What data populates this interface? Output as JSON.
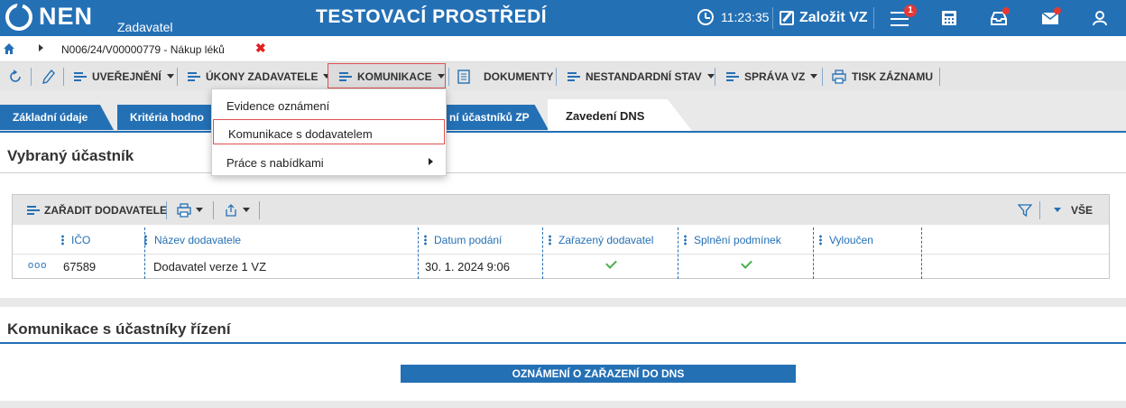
{
  "header": {
    "brand": "NEN",
    "brand_sub": "Zadavatel",
    "environment": "TESTOVACÍ PROSTŘEDÍ",
    "time": "11:23:35",
    "create_label": "Založit VZ",
    "notification_count": "1",
    "colors": {
      "bar": "#2470b5",
      "badge": "#e53935"
    },
    "icons": [
      "clock-icon",
      "edit-icon",
      "menu-icon",
      "calculator-icon",
      "inbox-icon",
      "mail-icon",
      "user-icon"
    ]
  },
  "breadcrumb": {
    "current": "N006/24/V00000779 - Nákup léků",
    "close": "✖"
  },
  "toolbar": {
    "publish": "UVEŘEJNĚNÍ",
    "acts": "ÚKONY ZADAVATELE",
    "communication": "KOMUNIKACE",
    "documents": "DOKUMENTY",
    "nonstandard": "NESTANDARDNÍ STAV",
    "management": "SPRÁVA VZ",
    "print": "TISK ZÁZNAMU"
  },
  "dropdown": {
    "items": [
      "Evidence oznámení",
      "Komunikace s dodavatelem",
      "Práce s nabídkami"
    ]
  },
  "tabs": {
    "basic": "Základní údaje",
    "criteria": "Kritéria hodno",
    "participants": "ní účastníků ZP",
    "active": "Zavedení DNS"
  },
  "selected_participant": {
    "title": "Vybraný účastník",
    "toolbar": {
      "add_supplier": "ZAŘADIT DODAVATELE",
      "all": "VŠE"
    },
    "columns": [
      "IČO",
      "Název dodavatele",
      "Datum podání",
      "Zařazený dodavatel",
      "Splnění podmínek",
      "Vyloučen"
    ],
    "rows": [
      {
        "more": "ooo",
        "ico": "67589",
        "name": "Dodavatel verze 1 VZ",
        "date": "30. 1. 2024 9:06",
        "assigned": true,
        "conditions": true,
        "excluded": false
      }
    ]
  },
  "communication": {
    "title": "Komunikace s účastníky řízení",
    "button": "OZNÁMENÍ O ZAŘAZENÍ DO DNS"
  }
}
